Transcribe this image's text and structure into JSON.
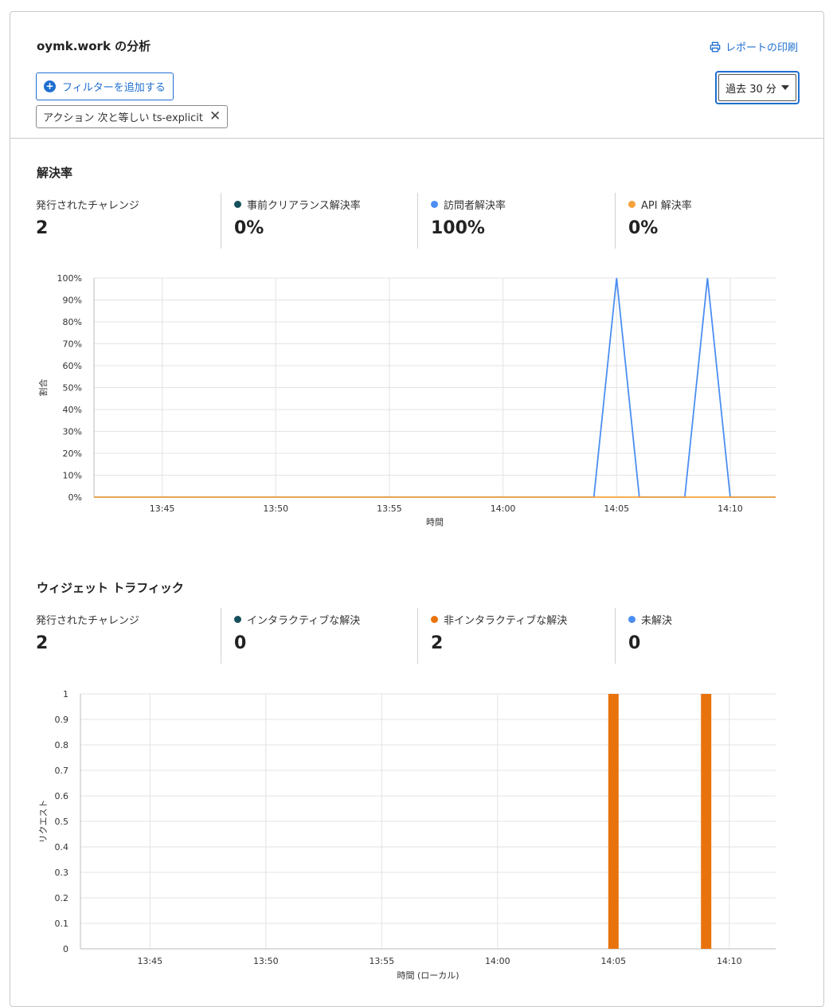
{
  "header": {
    "title": "oymk.work の分析",
    "print_label": "レポートの印刷",
    "add_filter_label": "フィルターを追加する",
    "filter_chip": "アクション 次と等しい ts-explicit",
    "time_range": "過去 30 分"
  },
  "solve_rate": {
    "title": "解決率",
    "stats": [
      {
        "label": "発行されたチャレンジ",
        "value": "2",
        "color": ""
      },
      {
        "label": "事前クリアランス解決率",
        "value": "0%",
        "color": "#15505c"
      },
      {
        "label": "訪問者解決率",
        "value": "100%",
        "color": "#4b8ef2"
      },
      {
        "label": "API 解決率",
        "value": "0%",
        "color": "#f6a23a"
      }
    ]
  },
  "widget_traffic": {
    "title": "ウィジェット トラフィック",
    "stats": [
      {
        "label": "発行されたチャレンジ",
        "value": "2",
        "color": ""
      },
      {
        "label": "インタラクティブな解決",
        "value": "0",
        "color": "#15505c"
      },
      {
        "label": "非インタラクティブな解決",
        "value": "2",
        "color": "#e8730d"
      },
      {
        "label": "未解決",
        "value": "0",
        "color": "#4b8ef2"
      }
    ]
  },
  "chart_data": [
    {
      "type": "line",
      "title": "",
      "xlabel": "時間",
      "ylabel": "割合",
      "x_tick_labels": [
        "13:45",
        "13:50",
        "13:55",
        "14:00",
        "14:05",
        "14:10"
      ],
      "y_tick_labels": [
        "0%",
        "10%",
        "20%",
        "30%",
        "40%",
        "50%",
        "60%",
        "70%",
        "80%",
        "90%",
        "100%"
      ],
      "xlim": [
        "13:42",
        "14:12"
      ],
      "ylim": [
        0,
        100
      ],
      "grid": true,
      "series": [
        {
          "color": "#4b8ef2",
          "x": [
            "13:42",
            "14:04",
            "14:05",
            "14:06",
            "14:08",
            "14:09",
            "14:10",
            "14:12"
          ],
          "values": [
            0,
            0,
            100,
            0,
            0,
            100,
            0,
            0
          ]
        },
        {
          "color": "#f6a23a",
          "x": [
            "13:42",
            "14:12"
          ],
          "values": [
            0,
            0
          ]
        }
      ]
    },
    {
      "type": "bar",
      "title": "",
      "xlabel": "時間 (ローカル)",
      "ylabel": "リクエスト",
      "x_tick_labels": [
        "13:45",
        "13:50",
        "13:55",
        "14:00",
        "14:05",
        "14:10"
      ],
      "y_tick_labels": [
        "0",
        "0.1",
        "0.2",
        "0.3",
        "0.4",
        "0.5",
        "0.6",
        "0.7",
        "0.8",
        "0.9",
        "1"
      ],
      "xlim": [
        "13:42",
        "14:12"
      ],
      "ylim": [
        0,
        1
      ],
      "grid": true,
      "series": [
        {
          "color": "#e8730d",
          "x": [
            "14:05",
            "14:09"
          ],
          "values": [
            1,
            1
          ]
        }
      ]
    }
  ]
}
